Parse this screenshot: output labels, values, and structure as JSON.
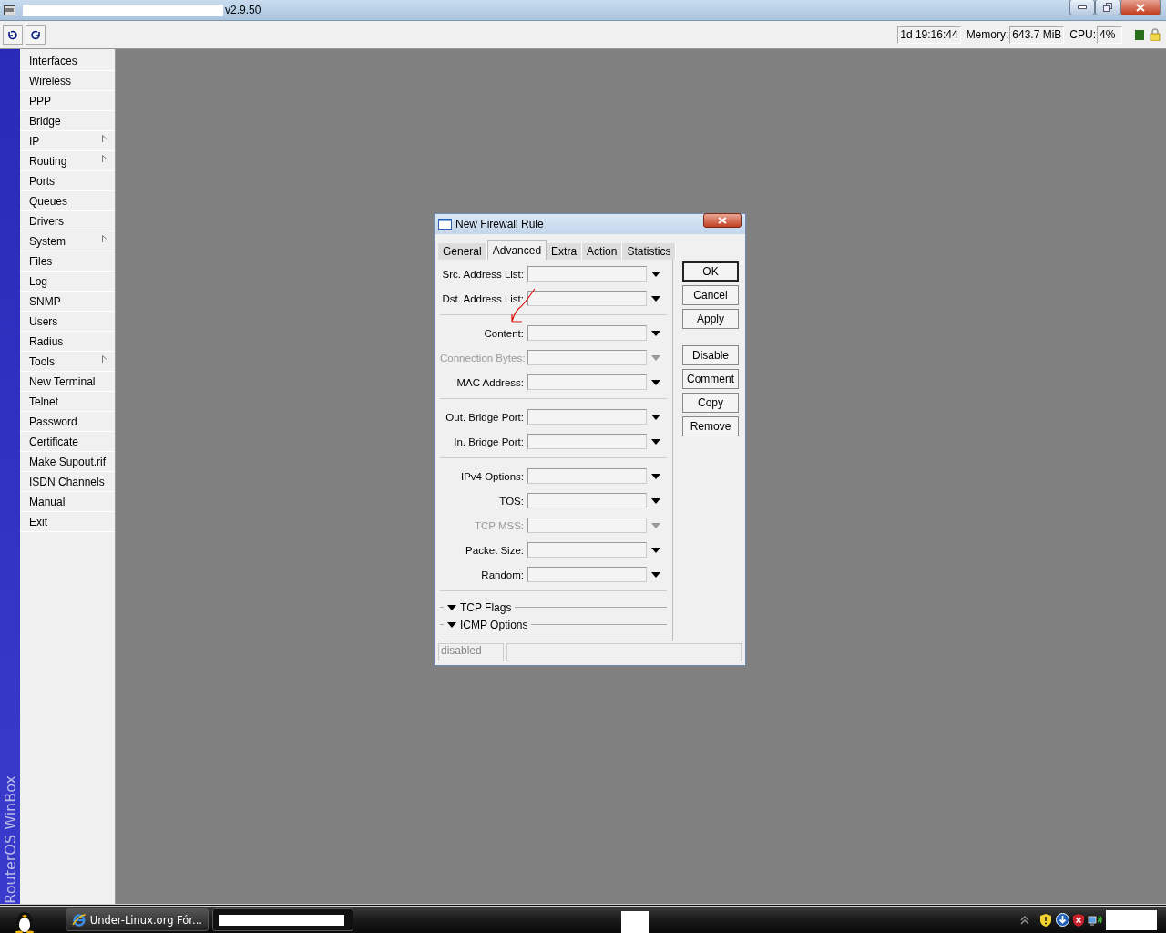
{
  "window": {
    "title": "v2.9.50"
  },
  "toolbar": {
    "uptime": "1d 19:16:44",
    "memory_label": "Memory:",
    "memory": "643.7 MiB",
    "cpu_label": "CPU:",
    "cpu": "4%"
  },
  "sidebar": {
    "brand": "RouterOS WinBox",
    "items": [
      {
        "label": "Interfaces",
        "submenu": false
      },
      {
        "label": "Wireless",
        "submenu": false
      },
      {
        "label": "PPP",
        "submenu": false
      },
      {
        "label": "Bridge",
        "submenu": false
      },
      {
        "label": "IP",
        "submenu": true
      },
      {
        "label": "Routing",
        "submenu": true
      },
      {
        "label": "Ports",
        "submenu": false
      },
      {
        "label": "Queues",
        "submenu": false
      },
      {
        "label": "Drivers",
        "submenu": false
      },
      {
        "label": "System",
        "submenu": true
      },
      {
        "label": "Files",
        "submenu": false
      },
      {
        "label": "Log",
        "submenu": false
      },
      {
        "label": "SNMP",
        "submenu": false
      },
      {
        "label": "Users",
        "submenu": false
      },
      {
        "label": "Radius",
        "submenu": false
      },
      {
        "label": "Tools",
        "submenu": true
      },
      {
        "label": "New Terminal",
        "submenu": false
      },
      {
        "label": "Telnet",
        "submenu": false
      },
      {
        "label": "Password",
        "submenu": false
      },
      {
        "label": "Certificate",
        "submenu": false
      },
      {
        "label": "Make Supout.rif",
        "submenu": false
      },
      {
        "label": "ISDN Channels",
        "submenu": false
      },
      {
        "label": "Manual",
        "submenu": false
      },
      {
        "label": "Exit",
        "submenu": false
      }
    ]
  },
  "dialog": {
    "title": "New Firewall Rule",
    "tabs": [
      {
        "label": "General",
        "selected": false
      },
      {
        "label": "Advanced",
        "selected": true
      },
      {
        "label": "Extra",
        "selected": false
      },
      {
        "label": "Action",
        "selected": false
      },
      {
        "label": "Statistics",
        "selected": false
      }
    ],
    "field_groups": [
      [
        {
          "label": "Src. Address List:",
          "disabled": false
        },
        {
          "label": "Dst. Address List:",
          "disabled": false
        }
      ],
      [
        {
          "label": "Content:",
          "disabled": false
        },
        {
          "label": "Connection Bytes:",
          "disabled": true
        },
        {
          "label": "MAC Address:",
          "disabled": false
        }
      ],
      [
        {
          "label": "Out. Bridge Port:",
          "disabled": false
        },
        {
          "label": "In. Bridge Port:",
          "disabled": false
        }
      ],
      [
        {
          "label": "IPv4 Options:",
          "disabled": false
        },
        {
          "label": "TOS:",
          "disabled": false
        },
        {
          "label": "TCP MSS:",
          "disabled": true
        },
        {
          "label": "Packet Size:",
          "disabled": false
        },
        {
          "label": "Random:",
          "disabled": false
        }
      ]
    ],
    "sections": [
      {
        "label": "TCP Flags"
      },
      {
        "label": "ICMP Options"
      }
    ],
    "buttons": [
      {
        "label": "OK",
        "default": true
      },
      {
        "label": "Cancel",
        "default": false
      },
      {
        "label": "Apply",
        "default": false
      },
      {
        "label": "Disable",
        "default": false
      },
      {
        "label": "Comment",
        "default": false
      },
      {
        "label": "Copy",
        "default": false
      },
      {
        "label": "Remove",
        "default": false
      }
    ],
    "status": "disabled"
  },
  "taskbar": {
    "tasks": [
      {
        "label": "Under-Linux.org Fór...",
        "kind": "browser"
      },
      {
        "kind": "redacted"
      }
    ]
  }
}
